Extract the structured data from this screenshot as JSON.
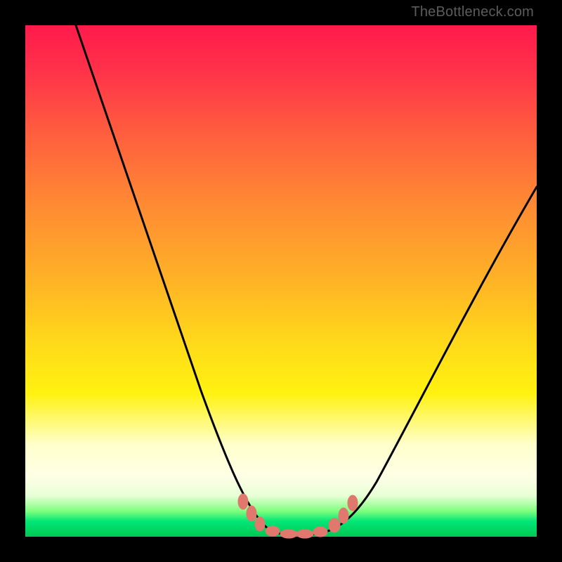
{
  "watermark": "TheBottleneck.com",
  "chart_data": {
    "type": "line",
    "title": "",
    "xlabel": "",
    "ylabel": "",
    "xlim": [
      0,
      100
    ],
    "ylim": [
      0,
      100
    ],
    "grid": false,
    "legend": false,
    "series": [
      {
        "name": "bottleneck-curve",
        "x": [
          10,
          15,
          20,
          25,
          30,
          35,
          40,
          42,
          44,
          46,
          48,
          50,
          52,
          54,
          56,
          58,
          60,
          65,
          70,
          75,
          80,
          85,
          90,
          95,
          100
        ],
        "y": [
          100,
          88,
          76,
          64,
          52,
          40,
          28,
          22,
          16,
          10,
          5,
          2,
          0.5,
          0,
          0,
          0.5,
          2,
          6,
          12,
          20,
          28,
          36,
          44,
          52,
          60
        ]
      }
    ],
    "markers": {
      "name": "highlight-points",
      "color": "#e0786e",
      "x": [
        42,
        44,
        46,
        49,
        51,
        54,
        56,
        59,
        61,
        63
      ],
      "y": [
        7,
        5,
        3,
        1.2,
        0.6,
        0.6,
        1.2,
        2.5,
        4,
        6
      ]
    },
    "background_gradient": {
      "top": "#ff1a4b",
      "mid": "#ffd91a",
      "bottom": "#00c853"
    }
  }
}
